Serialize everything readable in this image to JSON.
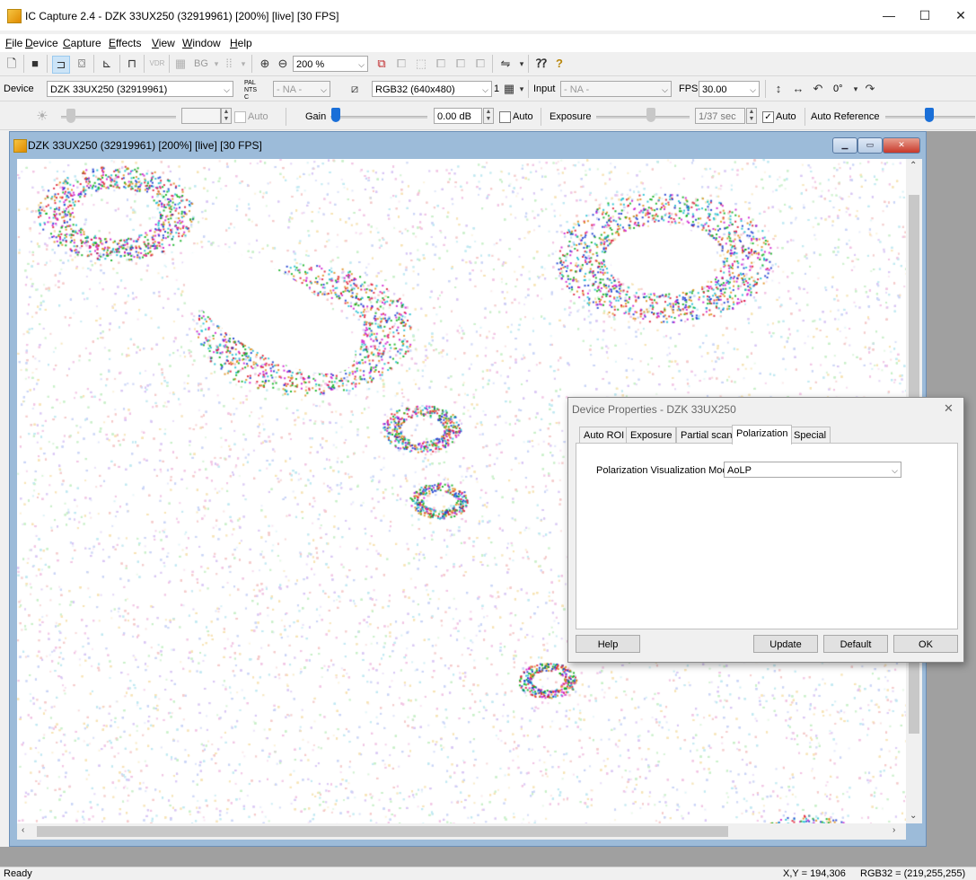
{
  "window": {
    "title": "IC Capture 2.4 - DZK 33UX250 (32919961) [200%]  [live]  [30 FPS]",
    "minimize": "—",
    "maximize": "☐",
    "close": "✕"
  },
  "menu": [
    "File",
    "Device",
    "Capture",
    "Effects",
    "View",
    "Window",
    "Help"
  ],
  "toolbar1": {
    "zoom_value": "200 %",
    "bg_label": "BG"
  },
  "toolbar2": {
    "device_label": "Device",
    "device_value": "DZK 33UX250 (32919961)",
    "pal_ntsc": "PAL NTSC",
    "video_norm_value": "- NA -",
    "format_value": "RGB32 (640x480)",
    "frames_label": "1",
    "input_label": "Input",
    "input_value": "- NA -",
    "fps_label": "FPS",
    "fps_value": "30.00",
    "rotation_value": "0°"
  },
  "toolbar3": {
    "brightness_auto": "Auto",
    "gain_label": "Gain",
    "gain_value": "0.00 dB",
    "gain_auto": "Auto",
    "exposure_label": "Exposure",
    "exposure_value": "1/37 sec",
    "exposure_auto": "Auto",
    "auto_reference_label": "Auto Reference"
  },
  "child_window": {
    "title": "DZK 33UX250 (32919961) [200%]  [live]  [30 FPS]"
  },
  "dialog": {
    "title": "Device Properties - DZK 33UX250",
    "tabs": [
      "Auto ROI",
      "Exposure",
      "Partial scan",
      "Polarization",
      "Special"
    ],
    "selected_tab": "Polarization",
    "field_label": "Polarization Visualization Mode",
    "field_value": "AoLP",
    "buttons": {
      "help": "Help",
      "update": "Update",
      "default": "Default",
      "ok": "OK"
    }
  },
  "status": {
    "left": "Ready",
    "coords": "X,Y = 194,306",
    "rgb": "RGB32 = (219,255,255)"
  },
  "colors": {
    "accent": "#1a6fd8",
    "mdi_frame": "#9cbbd9",
    "mdi_close": "#c8382a",
    "workspace": "#a0a0a0"
  }
}
